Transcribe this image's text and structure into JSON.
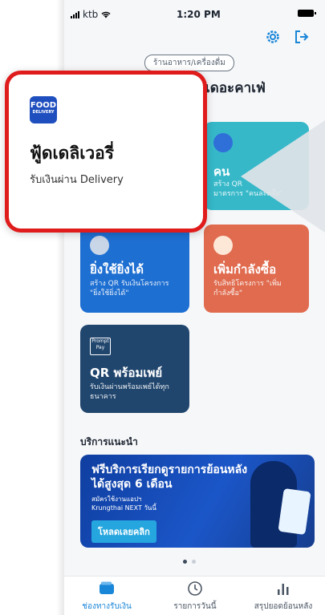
{
  "status_bar": {
    "carrier": "ktb",
    "time": "1:20 PM"
  },
  "header": {
    "category_pill": "ร้านอาหาร/เครื่องดื่ม",
    "section_title": "เดอะคาเฟ่"
  },
  "cards": {
    "teal": {
      "title": "คน",
      "desc": "สร้าง QR\nมาตรการ \"คนละครึ่ง\""
    },
    "blue": {
      "title": "ยิ่งใช้ยิ่งได้",
      "desc": "สร้าง QR รับเงินโครงการ\n\"ยิ่งใช้ยิ่งได้\""
    },
    "orange": {
      "title": "เพิ่มกำลังซื้อ",
      "desc": "รับสิทธิโครงการ \"เพิ่ม\nกำลังซื้อ\""
    },
    "navy": {
      "logo_text": "Prompt Pay",
      "title": "QR พร้อมเพย์",
      "desc": "รับเงินผ่านพร้อมเพย์ได้ทุก\nธนาคาร"
    }
  },
  "recommend": {
    "title": "บริการแนะนำ",
    "banner": {
      "headline": "ฟรีบริการเรียกดูรายการย้อนหลังได้สูงสุด 6 เดือน",
      "subtext": "สมัครใช้งานแอปฯ\nKrungthai NEXT วันนี้",
      "cta": "โหลดเลยคลิก"
    },
    "page_dots": 2,
    "active_dot": 0
  },
  "tabbar": {
    "tabs": [
      {
        "label": "ช่องทางรับเงิน",
        "icon": "wallet-icon",
        "active": true
      },
      {
        "label": "รายการวันนี้",
        "icon": "clock-icon",
        "active": false
      },
      {
        "label": "สรุปยอดย้อนหลัง",
        "icon": "bar-chart-icon",
        "active": false
      }
    ]
  },
  "popup": {
    "logo_line1": "FOOD",
    "logo_line2": "DELIVERY",
    "title": "ฟู้ดเดลิเวอรี่",
    "subtitle": "รับเงินผ่าน Delivery"
  },
  "colors": {
    "accent": "#1a86d8",
    "highlight_border": "#e01b1b"
  }
}
